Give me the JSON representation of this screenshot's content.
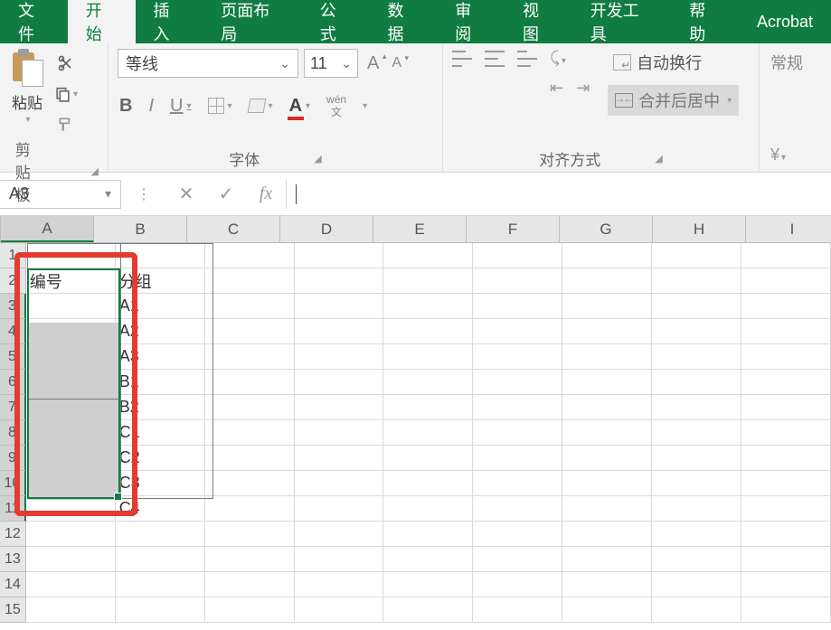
{
  "ribbon": {
    "tabs": {
      "file": "文件",
      "home": "开始",
      "insert": "插入",
      "page_layout": "页面布局",
      "formulas": "公式",
      "data": "数据",
      "review": "审阅",
      "view": "视图",
      "developer": "开发工具",
      "help": "帮助",
      "acrobat": "Acrobat"
    },
    "clipboard": {
      "paste": "粘贴",
      "group_label": "剪贴板"
    },
    "font": {
      "name": "等线",
      "size": "11",
      "group_label": "字体",
      "phonetic_top": "wén",
      "phonetic_bottom": "文"
    },
    "alignment": {
      "wrap_label": "自动换行",
      "merge_label": "合并后居中",
      "group_label": "对齐方式"
    },
    "number": {
      "format": "常规"
    }
  },
  "formula_bar": {
    "name_box": "A3",
    "formula": ""
  },
  "columns": [
    "A",
    "B",
    "C",
    "D",
    "E",
    "F",
    "G",
    "H",
    "I"
  ],
  "rows": [
    "1",
    "2",
    "3",
    "4",
    "5",
    "6",
    "7",
    "8",
    "9",
    "10",
    "11",
    "12",
    "13",
    "14",
    "15"
  ],
  "cells": {
    "A2": "编号",
    "B2": "分组",
    "B3": "A1",
    "B4": "A2",
    "B5": "A3",
    "B6": "B1",
    "B7": "B2",
    "B8": "C1",
    "B9": "C2",
    "B10": "C3",
    "B11": "C4"
  },
  "selection": {
    "active": "A3",
    "range": "A3:A11"
  },
  "selected_column": "A",
  "selected_rows": [
    "3",
    "4",
    "5",
    "6",
    "7",
    "8",
    "9",
    "10",
    "11"
  ]
}
